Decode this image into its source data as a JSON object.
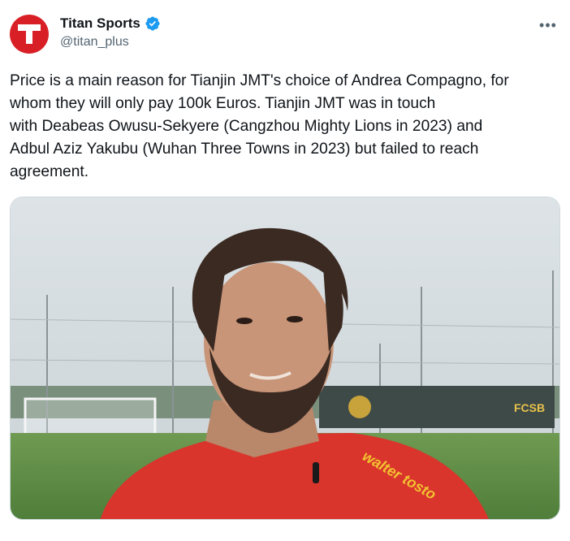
{
  "post": {
    "author": {
      "display_name": "Titan Sports",
      "handle": "@titan_plus",
      "avatar_letter": "T",
      "avatar_color": "#d91f26",
      "verified": true,
      "verified_color": "#1d9bf0"
    },
    "more_icon": "more-horizontal-icon",
    "text": "Price is a main reason for Tianjin JMT's choice of Andrea Compagno, for\nwhom they will only pay 100k Euros. Tianjin JMT was in touch\nwith Deabeas Owusu-Sekyere (Cangzhou Mighty Lions in 2023) and\nAdbul Aziz Yakubu (Wuhan Three Towns in 2023) but failed to reach\nagreement.",
    "media": {
      "shirt_sponsor": "walter tosto",
      "fence_text": "FCSB"
    }
  }
}
